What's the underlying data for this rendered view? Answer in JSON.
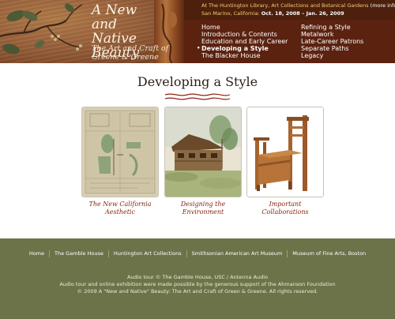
{
  "header": {
    "title_lines": [
      "A New",
      "and Native",
      "Beauty"
    ],
    "subtitle_lines": [
      "The Art and Craft of",
      "Greene & Greene"
    ],
    "info_line1": "At The Huntington Library, Art Collections and Botanical Gardens",
    "info_more": "(more info)",
    "info_line2_prefix": "San Marino, California:",
    "info_dates": "Oct. 18, 2008 – Jan. 26, 2009"
  },
  "nav": {
    "left": [
      {
        "label": "Home",
        "active": false
      },
      {
        "label": "Introduction & Contents",
        "active": false
      },
      {
        "label": "Education and Early Career",
        "active": false
      },
      {
        "label": "Developing a Style",
        "active": true
      },
      {
        "label": "The Blacker House",
        "active": false
      }
    ],
    "right": [
      {
        "label": "Refining a Style",
        "active": false
      },
      {
        "label": "Metalwork",
        "active": false
      },
      {
        "label": "Late-Career Patrons",
        "active": false
      },
      {
        "label": "Separate Paths",
        "active": false
      },
      {
        "label": "Legacy",
        "active": false
      }
    ]
  },
  "main": {
    "page_title": "Developing a Style",
    "cards": [
      {
        "caption_lines": [
          "The New California",
          "Aesthetic"
        ]
      },
      {
        "caption_lines": [
          "Designing the",
          "Environment"
        ]
      },
      {
        "caption_lines": [
          "Important Collaborations"
        ]
      }
    ]
  },
  "footer": {
    "links": [
      "Home",
      "The Gamble House",
      "Huntington Art Collections",
      "Smithsonian American Art Museum",
      "Museum of Fine Arts, Boston"
    ],
    "credits": [
      "Audio tour © The Gamble House, USC / Antenna Audio",
      "Audio tour and online exhibition were made possible by the generous support of the Ahmanson Foundation",
      "© 2009 A \"New and Native\" Beauty: The Art and Craft of Green & Greene. All rights reserved."
    ]
  },
  "colors": {
    "header_brown": "#5b2210",
    "info_yellow": "#f4d278",
    "caption_red": "#8a2411",
    "footer_olive": "#6d7348"
  }
}
